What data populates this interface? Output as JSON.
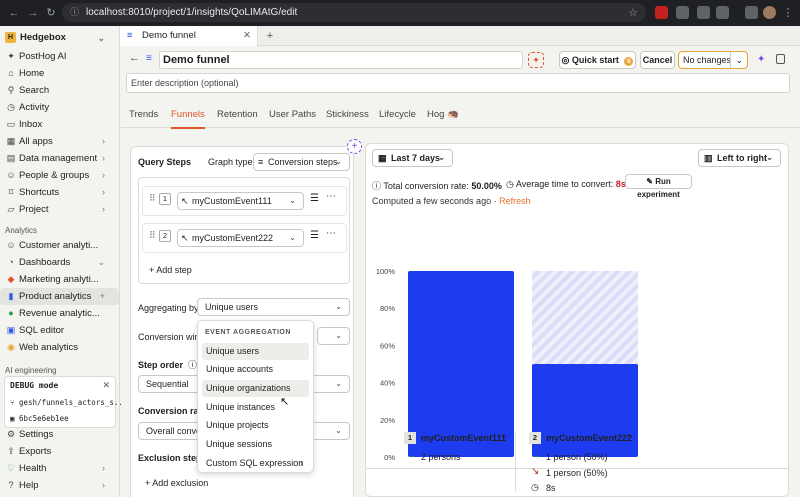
{
  "browser": {
    "url": "localhost:8010/project/1/insights/QoLIMAtG/edit"
  },
  "tab": {
    "title": "Demo funnel",
    "new_tab": "+"
  },
  "sidebar": {
    "project": "Hedgebox",
    "project_badge": "H",
    "items": [
      {
        "label": "PostHog AI",
        "icon": "sparkle-icon"
      },
      {
        "label": "Home",
        "icon": "home-icon"
      },
      {
        "label": "Search",
        "icon": "search-icon"
      },
      {
        "label": "Activity",
        "icon": "clock-icon"
      },
      {
        "label": "Inbox",
        "icon": "inbox-icon"
      },
      {
        "label": "All apps",
        "icon": "grid-icon"
      },
      {
        "label": "Data management",
        "icon": "database-icon"
      },
      {
        "label": "People & groups",
        "icon": "people-icon"
      },
      {
        "label": "Shortcuts",
        "icon": "bookmark-icon"
      },
      {
        "label": "Project",
        "icon": "folder-icon"
      }
    ],
    "analytics_section": "Analytics",
    "analytics_items": [
      {
        "label": "Customer analyti...",
        "icon": "users-icon"
      },
      {
        "label": "Dashboards",
        "icon": "dashboard-icon"
      },
      {
        "label": "Marketing analyti...",
        "icon": "megaphone-icon"
      },
      {
        "label": "Product analytics",
        "icon": "chart-icon"
      },
      {
        "label": "Revenue analytic...",
        "icon": "revenue-icon"
      },
      {
        "label": "SQL editor",
        "icon": "code-icon"
      },
      {
        "label": "Web analytics",
        "icon": "globe-icon"
      }
    ],
    "ai_section": "AI engineering",
    "debug": {
      "title": "DEBUG mode",
      "branch": "gesh/funnels_actors_s...",
      "commit": "6bc5e6eb1ee"
    },
    "bottom_items": [
      {
        "label": "Settings",
        "icon": "gear-icon"
      },
      {
        "label": "Exports",
        "icon": "export-icon"
      },
      {
        "label": "Health",
        "icon": "heart-icon"
      },
      {
        "label": "Help",
        "icon": "help-icon"
      }
    ]
  },
  "header": {
    "title": "Demo funnel",
    "description_placeholder": "Enter description (optional)",
    "quick_start": "Quick start",
    "quick_start_count": "6",
    "cancel": "Cancel",
    "save_state": "No changes"
  },
  "insight_tabs": [
    "Trends",
    "Funnels",
    "Retention",
    "User Paths",
    "Stickiness",
    "Lifecycle",
    "Hog 🦔"
  ],
  "active_tab": "Funnels",
  "query": {
    "title": "Query Steps",
    "graph_type_label": "Graph type",
    "graph_type_value": "Conversion steps",
    "steps": [
      {
        "num": "1",
        "event": "myCustomEvent111"
      },
      {
        "num": "2",
        "event": "myCustomEvent222"
      }
    ],
    "add_step": "Add step",
    "aggregating_label": "Aggregating by",
    "aggregating_value": "Unique users",
    "conversion_window_label": "Conversion wind",
    "step_order_label": "Step order",
    "step_order_value": "Sequential",
    "conversion_rate_label": "Conversion rate",
    "conversion_rate_value": "Overall conver",
    "exclusion_label": "Exclusion steps",
    "add_exclusion": "Add exclusion"
  },
  "dropdown": {
    "heading": "EVENT AGGREGATION",
    "options": [
      "Unique users",
      "Unique accounts",
      "Unique organizations",
      "Unique instances",
      "Unique projects",
      "Unique sessions",
      "Custom SQL expression"
    ],
    "selected": "Unique users",
    "hovered": "Unique organizations"
  },
  "results": {
    "date_range": "Last 7 days",
    "layout": "Left to right",
    "total_conversion_label": "Total conversion rate:",
    "total_conversion_value": "50.00%",
    "avg_time_label": "Average time to convert:",
    "avg_time_value": "8s",
    "run_experiment": "Run experiment",
    "computed": "Computed a few seconds ago",
    "separator": "·",
    "refresh": "Refresh",
    "legend": [
      {
        "num": "1",
        "name": "myCustomEvent111",
        "persons": "2 persons"
      },
      {
        "num": "2",
        "name": "myCustomEvent222",
        "converted": "1 person (50%)",
        "dropped": "1 person (50%)",
        "time": "8s"
      }
    ]
  },
  "chart_data": {
    "type": "bar",
    "categories": [
      "myCustomEvent111",
      "myCustomEvent222"
    ],
    "values": [
      100,
      50
    ],
    "ylim": [
      0,
      100
    ],
    "yticks": [
      "100%",
      "80%",
      "60%",
      "40%",
      "20%",
      "0%"
    ],
    "bar_color": "#1d3cf0"
  }
}
